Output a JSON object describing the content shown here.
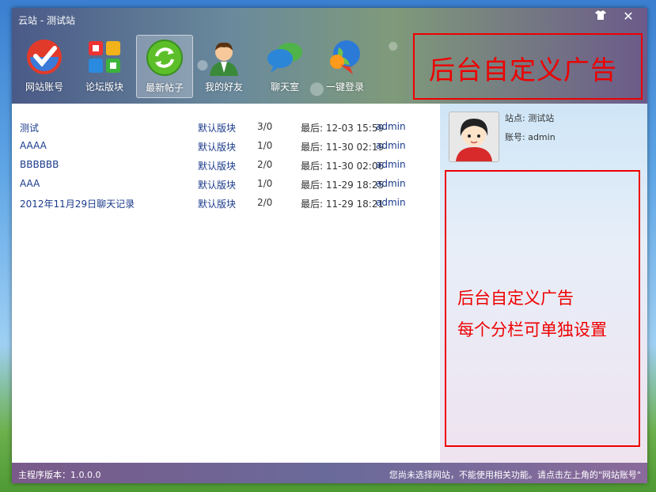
{
  "window": {
    "title": "云站 - 测试站"
  },
  "nav": [
    {
      "label": "网站账号",
      "icon": "check-icon"
    },
    {
      "label": "论坛版块",
      "icon": "grid-icon"
    },
    {
      "label": "最新帖子",
      "icon": "refresh-icon"
    },
    {
      "label": "我的好友",
      "icon": "user-icon"
    },
    {
      "label": "聊天室",
      "icon": "chat-icon"
    },
    {
      "label": "一键登录",
      "icon": "globe-icon"
    }
  ],
  "ad_top": {
    "text": "后台自定义广告"
  },
  "posts": [
    {
      "title": "测试",
      "board": "默认版块",
      "count": "3/0",
      "last": "最后: 12-03 15:59",
      "author": "admin"
    },
    {
      "title": "AAAA",
      "board": "默认版块",
      "count": "1/0",
      "last": "最后: 11-30 02:19",
      "author": "admin"
    },
    {
      "title": "BBBBBB",
      "board": "默认版块",
      "count": "2/0",
      "last": "最后: 11-30 02:06",
      "author": "admin"
    },
    {
      "title": "AAA",
      "board": "默认版块",
      "count": "1/0",
      "last": "最后: 11-29 18:25",
      "author": "admin"
    },
    {
      "title": "2012年11月29日聊天记录",
      "board": "默认版块",
      "count": "2/0",
      "last": "最后: 11-29 18:21",
      "author": "admin"
    }
  ],
  "side": {
    "site": "站点: 测试站",
    "account": "账号: admin",
    "ad_line1": "后台自定义广告",
    "ad_line2": "每个分栏可单独设置"
  },
  "status": {
    "version": "主程序版本：1.0.0.0",
    "message": "您尚未选择网站，不能使用相关功能。请点击左上角的\"网站账号\""
  }
}
